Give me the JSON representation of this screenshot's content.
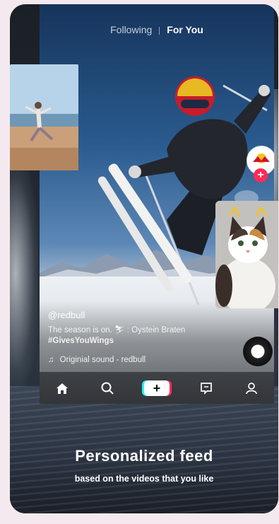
{
  "topnav": {
    "following": "Following",
    "for_you": "For You"
  },
  "post": {
    "username": "@redbull",
    "caption": "The season is on. ⛷ : Oystein Braten",
    "hashtag": "#GivesYouWings",
    "sound": "Originial sound - redbull",
    "avatar_brand": "Red Bull"
  },
  "bottom_nav": [
    "home-icon",
    "search-icon",
    "create-icon",
    "inbox-icon",
    "profile-icon"
  ],
  "headline": "Personalized feed",
  "subline": "based on the videos that you like",
  "colors": {
    "accent_red": "#fe2c55",
    "accent_cyan": "#25f4ee",
    "background": "#f4e9ee"
  }
}
